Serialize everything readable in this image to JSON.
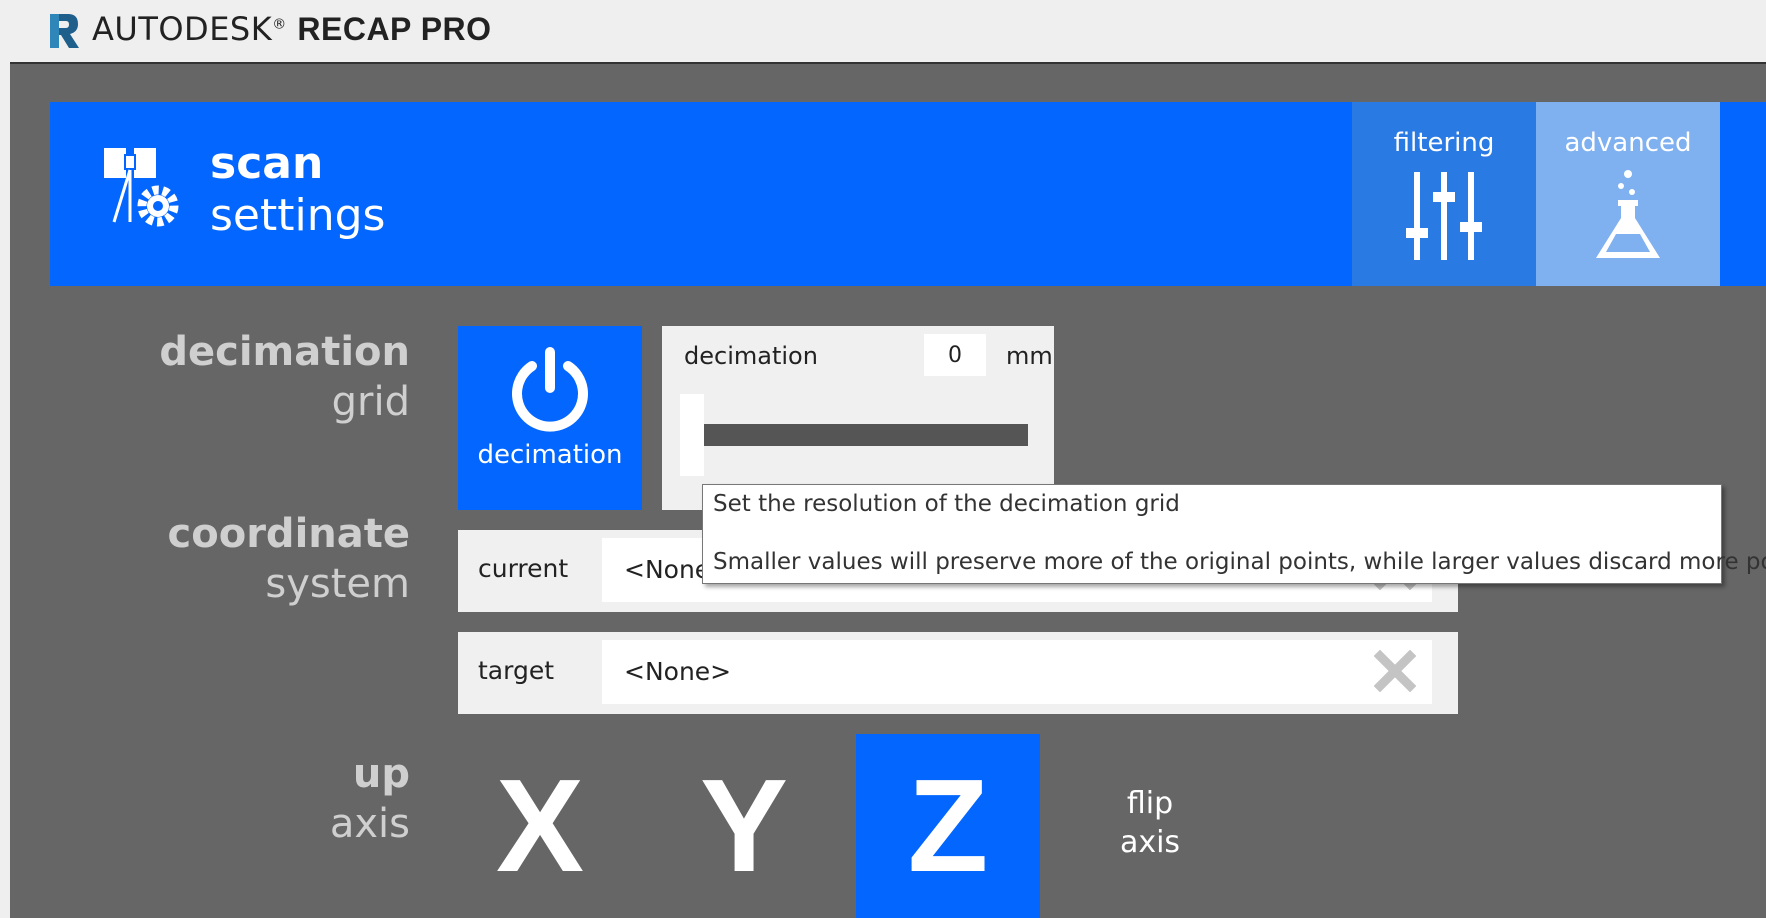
{
  "app": {
    "brand_light": "AUTODESK",
    "brand_reg": "®",
    "brand_bold": "RECAP PRO"
  },
  "header": {
    "title_bold": "scan",
    "title_light": "settings"
  },
  "tabs": [
    {
      "label": "filtering",
      "icon": "sliders-icon"
    },
    {
      "label": "advanced",
      "icon": "flask-icon"
    }
  ],
  "decimation": {
    "section_bold": "decimation",
    "section_light": "grid",
    "toggle_label": "decimation",
    "slider_label": "decimation",
    "value": "0",
    "unit": "mm"
  },
  "coordinate": {
    "section_bold": "coordinate",
    "section_light": "system",
    "current_label": "current",
    "current_value": "<None>",
    "target_label": "target",
    "target_value": "<None>"
  },
  "up_axis": {
    "section_bold": "up",
    "section_light": "axis",
    "x": "X",
    "y": "Y",
    "z": "Z",
    "selected": "Z",
    "flip_line1": "flip",
    "flip_line2": "axis"
  },
  "tooltip": {
    "line1": "Set the resolution of the decimation grid",
    "line2": "Smaller values will preserve more of the original points, while larger values discard more points"
  },
  "colors": {
    "accent": "#0366ff",
    "panel": "#666666",
    "tab_filtering": "#2a7ae4",
    "tab_advanced": "#7fb0f0"
  }
}
